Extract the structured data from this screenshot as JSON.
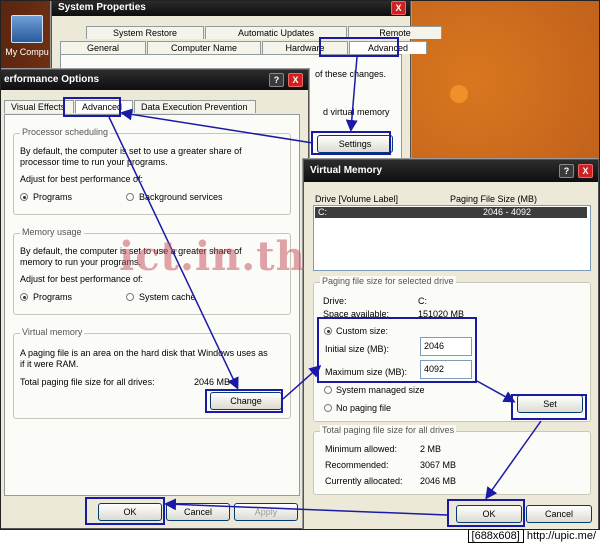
{
  "desktop": {
    "icon_label": "My Compu"
  },
  "system_properties": {
    "title": "System Properties",
    "tabs_row1": [
      "System Restore",
      "Automatic Updates",
      "Remote"
    ],
    "tabs_row2": [
      "General",
      "Computer Name",
      "Hardware",
      "Advanced"
    ],
    "partial_text_1": "of these changes.",
    "partial_text_2": "d virtual memory",
    "settings_label": "Settings"
  },
  "performance_options": {
    "title": "erformance Options",
    "help": "?",
    "close": "X",
    "tabs": [
      "Visual Effects",
      "Advanced",
      "Data Execution Prevention"
    ],
    "processor": {
      "heading": "Processor scheduling",
      "desc1": "By default, the computer is set to use a greater share of",
      "desc2": "processor time to run your programs.",
      "adjust": "Adjust for best performance of:",
      "opt1": "Programs",
      "opt2": "Background services"
    },
    "memory": {
      "heading": "Memory usage",
      "desc1": "By default, the computer is set to use a greater share of",
      "desc2": "memory to run your programs.",
      "adjust": "Adjust for best performance of:",
      "opt1": "Programs",
      "opt2": "System cache"
    },
    "virtual": {
      "heading": "Virtual memory",
      "desc1": "A paging file is an area on the hard disk that Windows uses as",
      "desc2": "if it were RAM.",
      "total_label": "Total paging file size for all drives:",
      "total_value": "2046 MB",
      "change_label": "Change"
    },
    "ok": "OK",
    "cancel": "Cancel",
    "apply": "Apply"
  },
  "virtual_memory": {
    "title": "Virtual Memory",
    "help": "?",
    "close": "X",
    "col_drive": "Drive  [Volume Label]",
    "col_size": "Paging File Size (MB)",
    "drive_row": {
      "drive": "C:",
      "size": "2046 - 4092"
    },
    "selected_heading": "Paging file size for selected drive",
    "drive_label": "Drive:",
    "drive_value": "C:",
    "space_label": "Space available:",
    "space_value": "151020 MB",
    "custom_size": "Custom size:",
    "initial_label": "Initial size (MB):",
    "initial_value": "2046",
    "max_label": "Maximum size (MB):",
    "max_value": "4092",
    "system_managed": "System managed size",
    "no_paging": "No paging file",
    "set_label": "Set",
    "total_heading": "Total paging file size for all drives",
    "min_label": "Minimum allowed:",
    "min_value": "2 MB",
    "rec_label": "Recommended:",
    "rec_value": "3067 MB",
    "alloc_label": "Currently allocated:",
    "alloc_value": "2046 MB",
    "ok": "OK",
    "cancel": "Cancel"
  },
  "watermark": "ict.in.th",
  "footer": {
    "size": "[688x608]",
    "link": "http://upic.me/"
  },
  "colors": {
    "annotation": "#1a1aa6",
    "titlebar": "#111111",
    "dialog": "#ece9d8"
  }
}
